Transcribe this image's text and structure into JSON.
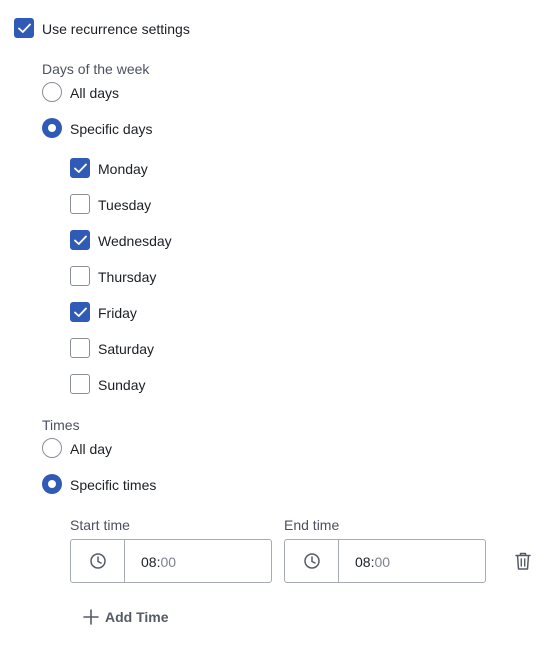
{
  "recurrence": {
    "use_label": "Use recurrence settings",
    "use_checked": true
  },
  "days": {
    "section_label": "Days of the week",
    "all_days_label": "All days",
    "specific_days_label": "Specific days",
    "mode": "specific",
    "items": [
      {
        "label": "Monday",
        "checked": true
      },
      {
        "label": "Tuesday",
        "checked": false
      },
      {
        "label": "Wednesday",
        "checked": true
      },
      {
        "label": "Thursday",
        "checked": false
      },
      {
        "label": "Friday",
        "checked": true
      },
      {
        "label": "Saturday",
        "checked": false
      },
      {
        "label": "Sunday",
        "checked": false
      }
    ]
  },
  "times": {
    "section_label": "Times",
    "all_day_label": "All day",
    "specific_times_label": "Specific times",
    "mode": "specific",
    "start": {
      "label": "Start time",
      "hours": "08",
      "separator": ":",
      "minutes": "00"
    },
    "end": {
      "label": "End time",
      "hours": "08",
      "separator": ":",
      "minutes": "00"
    },
    "add_time_label": "Add Time"
  },
  "colors": {
    "accent": "#2f5bb7",
    "border": "#8a8f98"
  },
  "icons": {
    "checkmark": "check-icon",
    "clock": "clock-icon",
    "trash": "trash-icon",
    "add": "plus-icon"
  }
}
